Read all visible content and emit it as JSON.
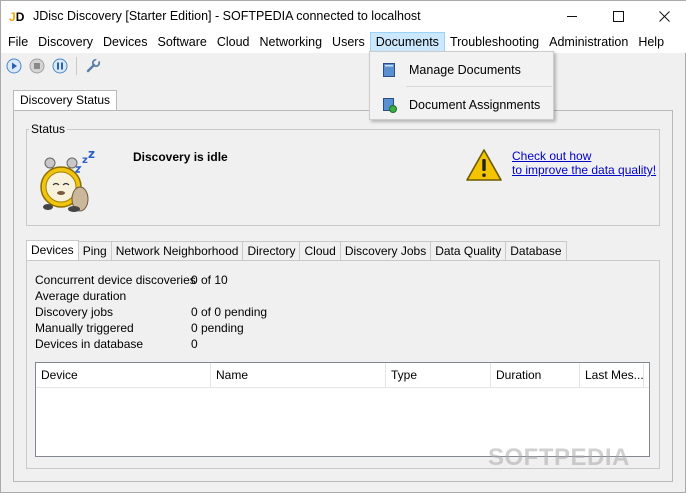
{
  "window": {
    "title": "JDisc Discovery [Starter Edition]  - SOFTPEDIA connected to localhost",
    "app_icon_letters": "JD"
  },
  "menubar": {
    "items": [
      "File",
      "Discovery",
      "Devices",
      "Software",
      "Cloud",
      "Networking",
      "Users",
      "Documents",
      "Troubleshooting",
      "Administration",
      "Help"
    ],
    "active": "Documents"
  },
  "documents_menu": {
    "items": [
      "Manage Documents",
      "Document Assignments"
    ]
  },
  "toolbar": {
    "icons": [
      "play-icon",
      "stop-icon",
      "pause-icon",
      "wrench-icon"
    ]
  },
  "outer_tab": {
    "label": "Discovery Status"
  },
  "status": {
    "legend": "Status",
    "message": "Discovery is idle",
    "link_line1": "Check out how",
    "link_line2": "to improve the data quality!"
  },
  "inner_tabs": {
    "items": [
      "Devices",
      "Ping",
      "Network Neighborhood",
      "Directory",
      "Cloud",
      "Discovery Jobs",
      "Data Quality",
      "Database"
    ],
    "selected": "Devices"
  },
  "stats": [
    {
      "label": "Concurrent device discoveries",
      "value": "0 of 10"
    },
    {
      "label": "Average duration",
      "value": ""
    },
    {
      "label": "Discovery jobs",
      "value": "0 of 0 pending"
    },
    {
      "label": "Manually triggered",
      "value": "0 pending"
    },
    {
      "label": "Devices in database",
      "value": "0"
    }
  ],
  "table": {
    "columns": [
      "Device",
      "Name",
      "Type",
      "Duration",
      "Last Mes..."
    ]
  },
  "watermark": "SOFTPEDIA",
  "colors": {
    "link": "#0000cc",
    "menu_active_bg": "#cce8ff",
    "warning": "#f4c400"
  }
}
